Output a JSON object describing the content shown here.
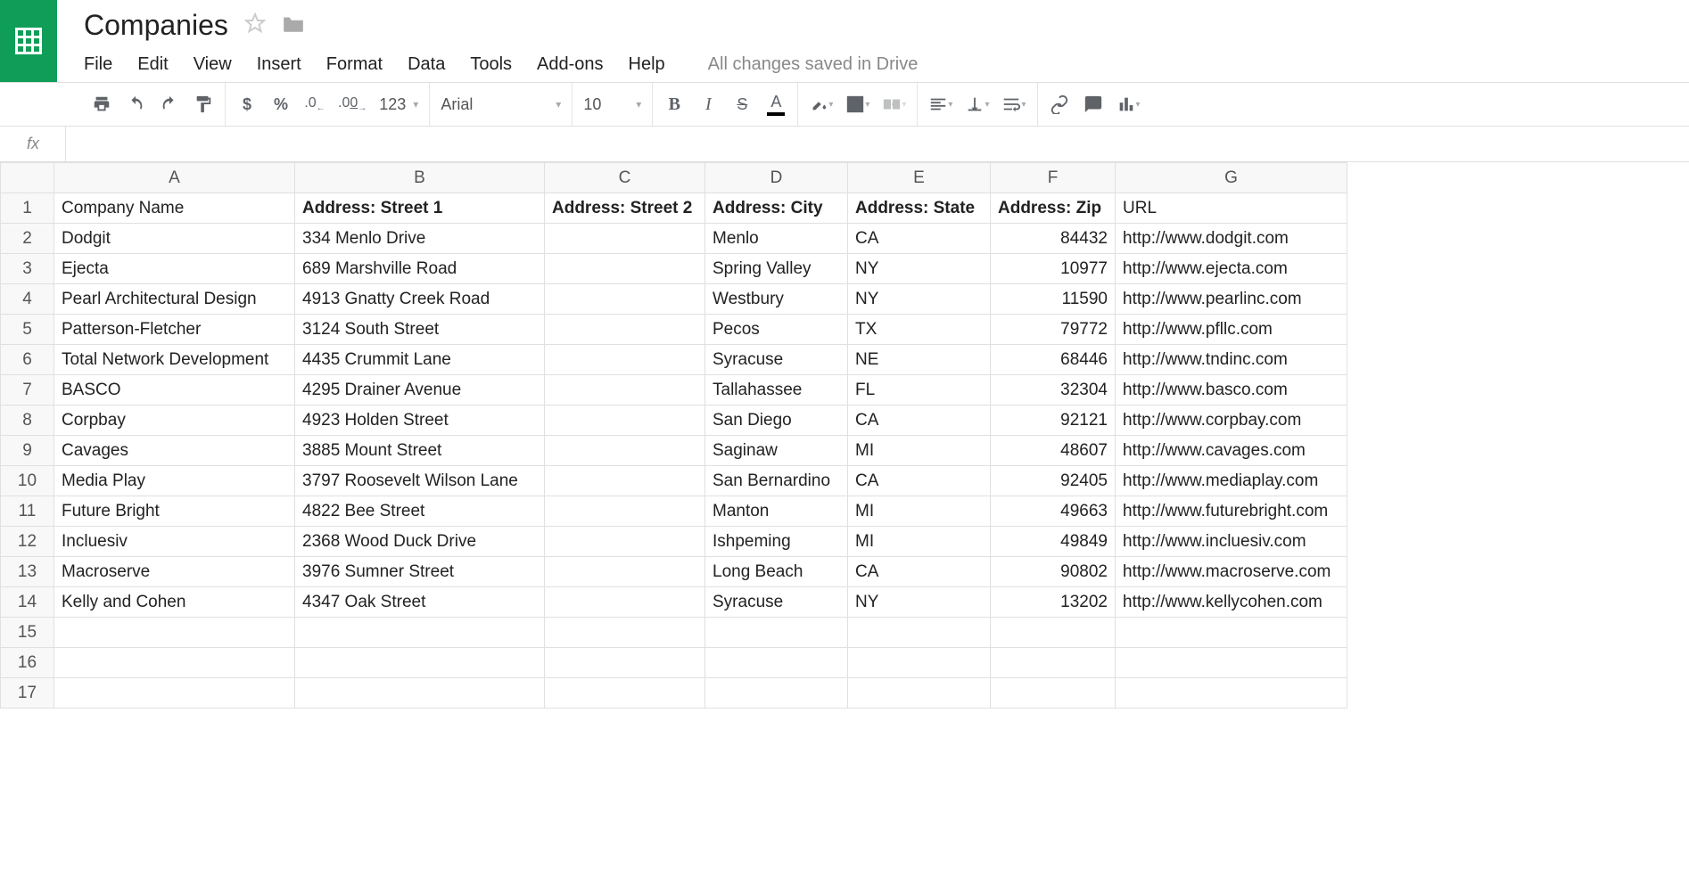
{
  "doc": {
    "title": "Companies",
    "save_status": "All changes saved in Drive"
  },
  "menu": {
    "file": "File",
    "edit": "Edit",
    "view": "View",
    "insert": "Insert",
    "format": "Format",
    "data": "Data",
    "tools": "Tools",
    "addons": "Add-ons",
    "help": "Help"
  },
  "toolbar": {
    "currency": "$",
    "percent": "%",
    "dec_dec": ".0",
    "inc_dec": ".00",
    "more_formats": "123",
    "font": "Arial",
    "font_size": "10"
  },
  "formula_bar": {
    "fx": "fx",
    "value": ""
  },
  "columns": [
    "A",
    "B",
    "C",
    "D",
    "E",
    "F",
    "G"
  ],
  "col_widths": [
    "colA",
    "colB",
    "colC",
    "colD",
    "colE",
    "colF",
    "colG"
  ],
  "header_row": {
    "c0": "Company Name",
    "c1": "Address: Street 1",
    "c2": "Address: Street 2",
    "c3": "Address: City",
    "c4": "Address: State",
    "c5": "Address: Zip",
    "c6": "URL"
  },
  "header_bold": [
    false,
    true,
    true,
    true,
    true,
    true,
    false
  ],
  "rows": [
    {
      "c0": "Dodgit",
      "c1": "334 Menlo Drive",
      "c2": "",
      "c3": "Menlo",
      "c4": "CA",
      "c5": "84432",
      "c6": "http://www.dodgit.com"
    },
    {
      "c0": "Ejecta",
      "c1": "689 Marshville Road",
      "c2": "",
      "c3": "Spring Valley",
      "c4": "NY",
      "c5": "10977",
      "c6": "http://www.ejecta.com"
    },
    {
      "c0": "Pearl Architectural Design",
      "c1": "4913 Gnatty Creek Road",
      "c2": "",
      "c3": "Westbury",
      "c4": "NY",
      "c5": "11590",
      "c6": "http://www.pearlinc.com"
    },
    {
      "c0": "Patterson-Fletcher",
      "c1": "3124 South Street",
      "c2": "",
      "c3": "Pecos",
      "c4": "TX",
      "c5": "79772",
      "c6": "http://www.pfllc.com"
    },
    {
      "c0": "Total Network Development",
      "c1": "4435 Crummit Lane",
      "c2": "",
      "c3": "Syracuse",
      "c4": "NE",
      "c5": "68446",
      "c6": "http://www.tndinc.com"
    },
    {
      "c0": "BASCO",
      "c1": "4295 Drainer Avenue",
      "c2": "",
      "c3": "Tallahassee",
      "c4": "FL",
      "c5": "32304",
      "c6": "http://www.basco.com"
    },
    {
      "c0": "Corpbay",
      "c1": "4923 Holden Street",
      "c2": "",
      "c3": "San Diego",
      "c4": "CA",
      "c5": "92121",
      "c6": "http://www.corpbay.com"
    },
    {
      "c0": "Cavages",
      "c1": "3885 Mount Street",
      "c2": "",
      "c3": "Saginaw",
      "c4": "MI",
      "c5": "48607",
      "c6": "http://www.cavages.com"
    },
    {
      "c0": "Media Play",
      "c1": "3797 Roosevelt Wilson Lane",
      "c2": "",
      "c3": "San Bernardino",
      "c4": "CA",
      "c5": "92405",
      "c6": "http://www.mediaplay.com"
    },
    {
      "c0": "Future Bright",
      "c1": "4822 Bee Street",
      "c2": "",
      "c3": "Manton",
      "c4": "MI",
      "c5": "49663",
      "c6": "http://www.futurebright.com"
    },
    {
      "c0": "Incluesiv",
      "c1": "2368 Wood Duck Drive",
      "c2": "",
      "c3": "Ishpeming",
      "c4": "MI",
      "c5": "49849",
      "c6": "http://www.incluesiv.com"
    },
    {
      "c0": "Macroserve",
      "c1": "3976 Sumner Street",
      "c2": "",
      "c3": "Long Beach",
      "c4": "CA",
      "c5": "90802",
      "c6": "http://www.macroserve.com"
    },
    {
      "c0": "Kelly and Cohen",
      "c1": "4347 Oak Street",
      "c2": "",
      "c3": "Syracuse",
      "c4": "NY",
      "c5": "13202",
      "c6": "http://www.kellycohen.com"
    }
  ],
  "empty_rows": 3
}
